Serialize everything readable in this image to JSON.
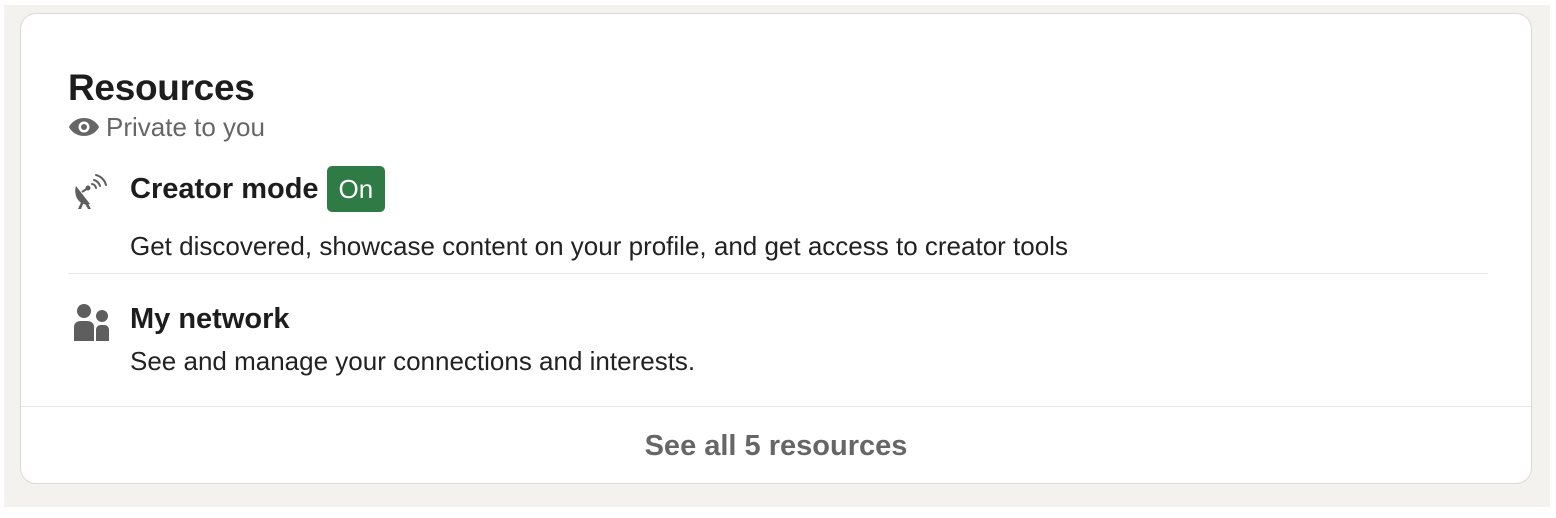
{
  "resources_card": {
    "title": "Resources",
    "privacy_label": "Private to you",
    "privacy_icon": "eye-icon",
    "items": [
      {
        "icon": "satellite-dish-icon",
        "title": "Creator mode",
        "badge": "On",
        "badge_color": "#2f7b45",
        "description": "Get discovered, showcase content on your profile, and get access to creator tools"
      },
      {
        "icon": "people-icon",
        "title": "My network",
        "description": "See and manage your connections and interests."
      }
    ],
    "footer_link": "See all 5 resources"
  },
  "colors": {
    "page_background": "#f3f2ef",
    "card_background": "#ffffff",
    "primary_text": "#1d1d1d",
    "secondary_text": "#666666"
  }
}
